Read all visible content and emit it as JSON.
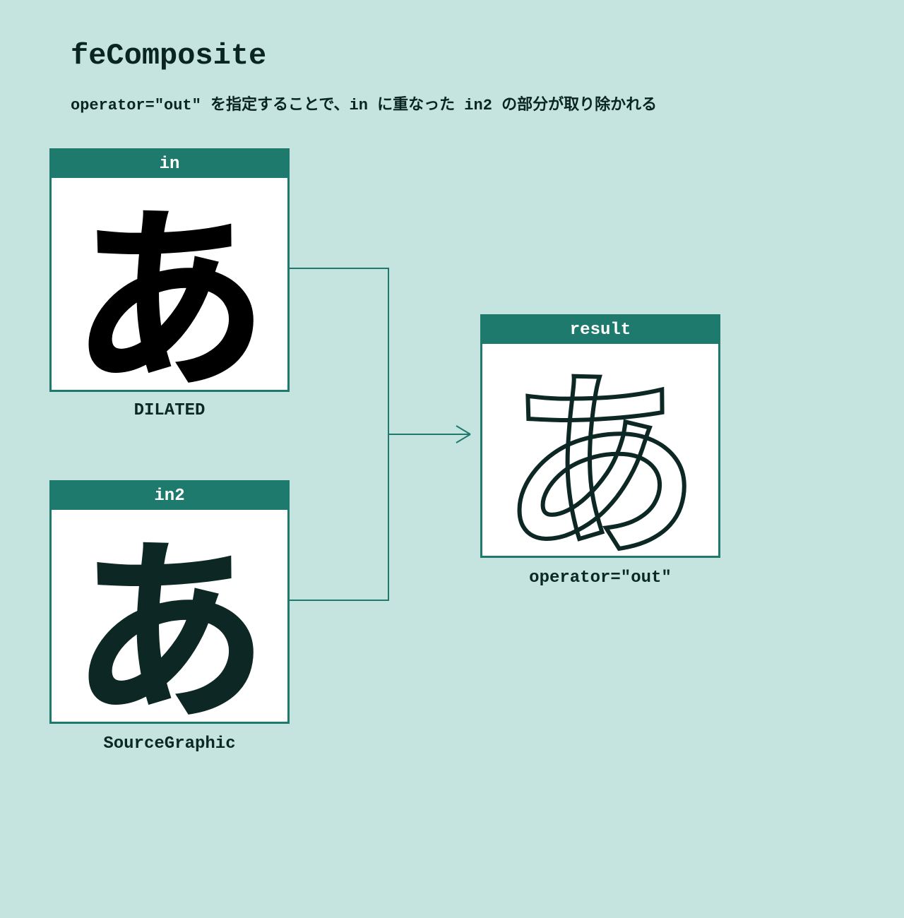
{
  "title": "feComposite",
  "description": "operator=\"out\" を指定することで、in に重なった in2 の部分が取り除かれる",
  "boxes": {
    "in": {
      "header": "in",
      "glyph": "あ",
      "caption": "DILATED"
    },
    "in2": {
      "header": "in2",
      "glyph": "あ",
      "caption": "SourceGraphic"
    },
    "result": {
      "header": "result",
      "glyph": "あ",
      "caption": "operator=\"out\""
    }
  }
}
